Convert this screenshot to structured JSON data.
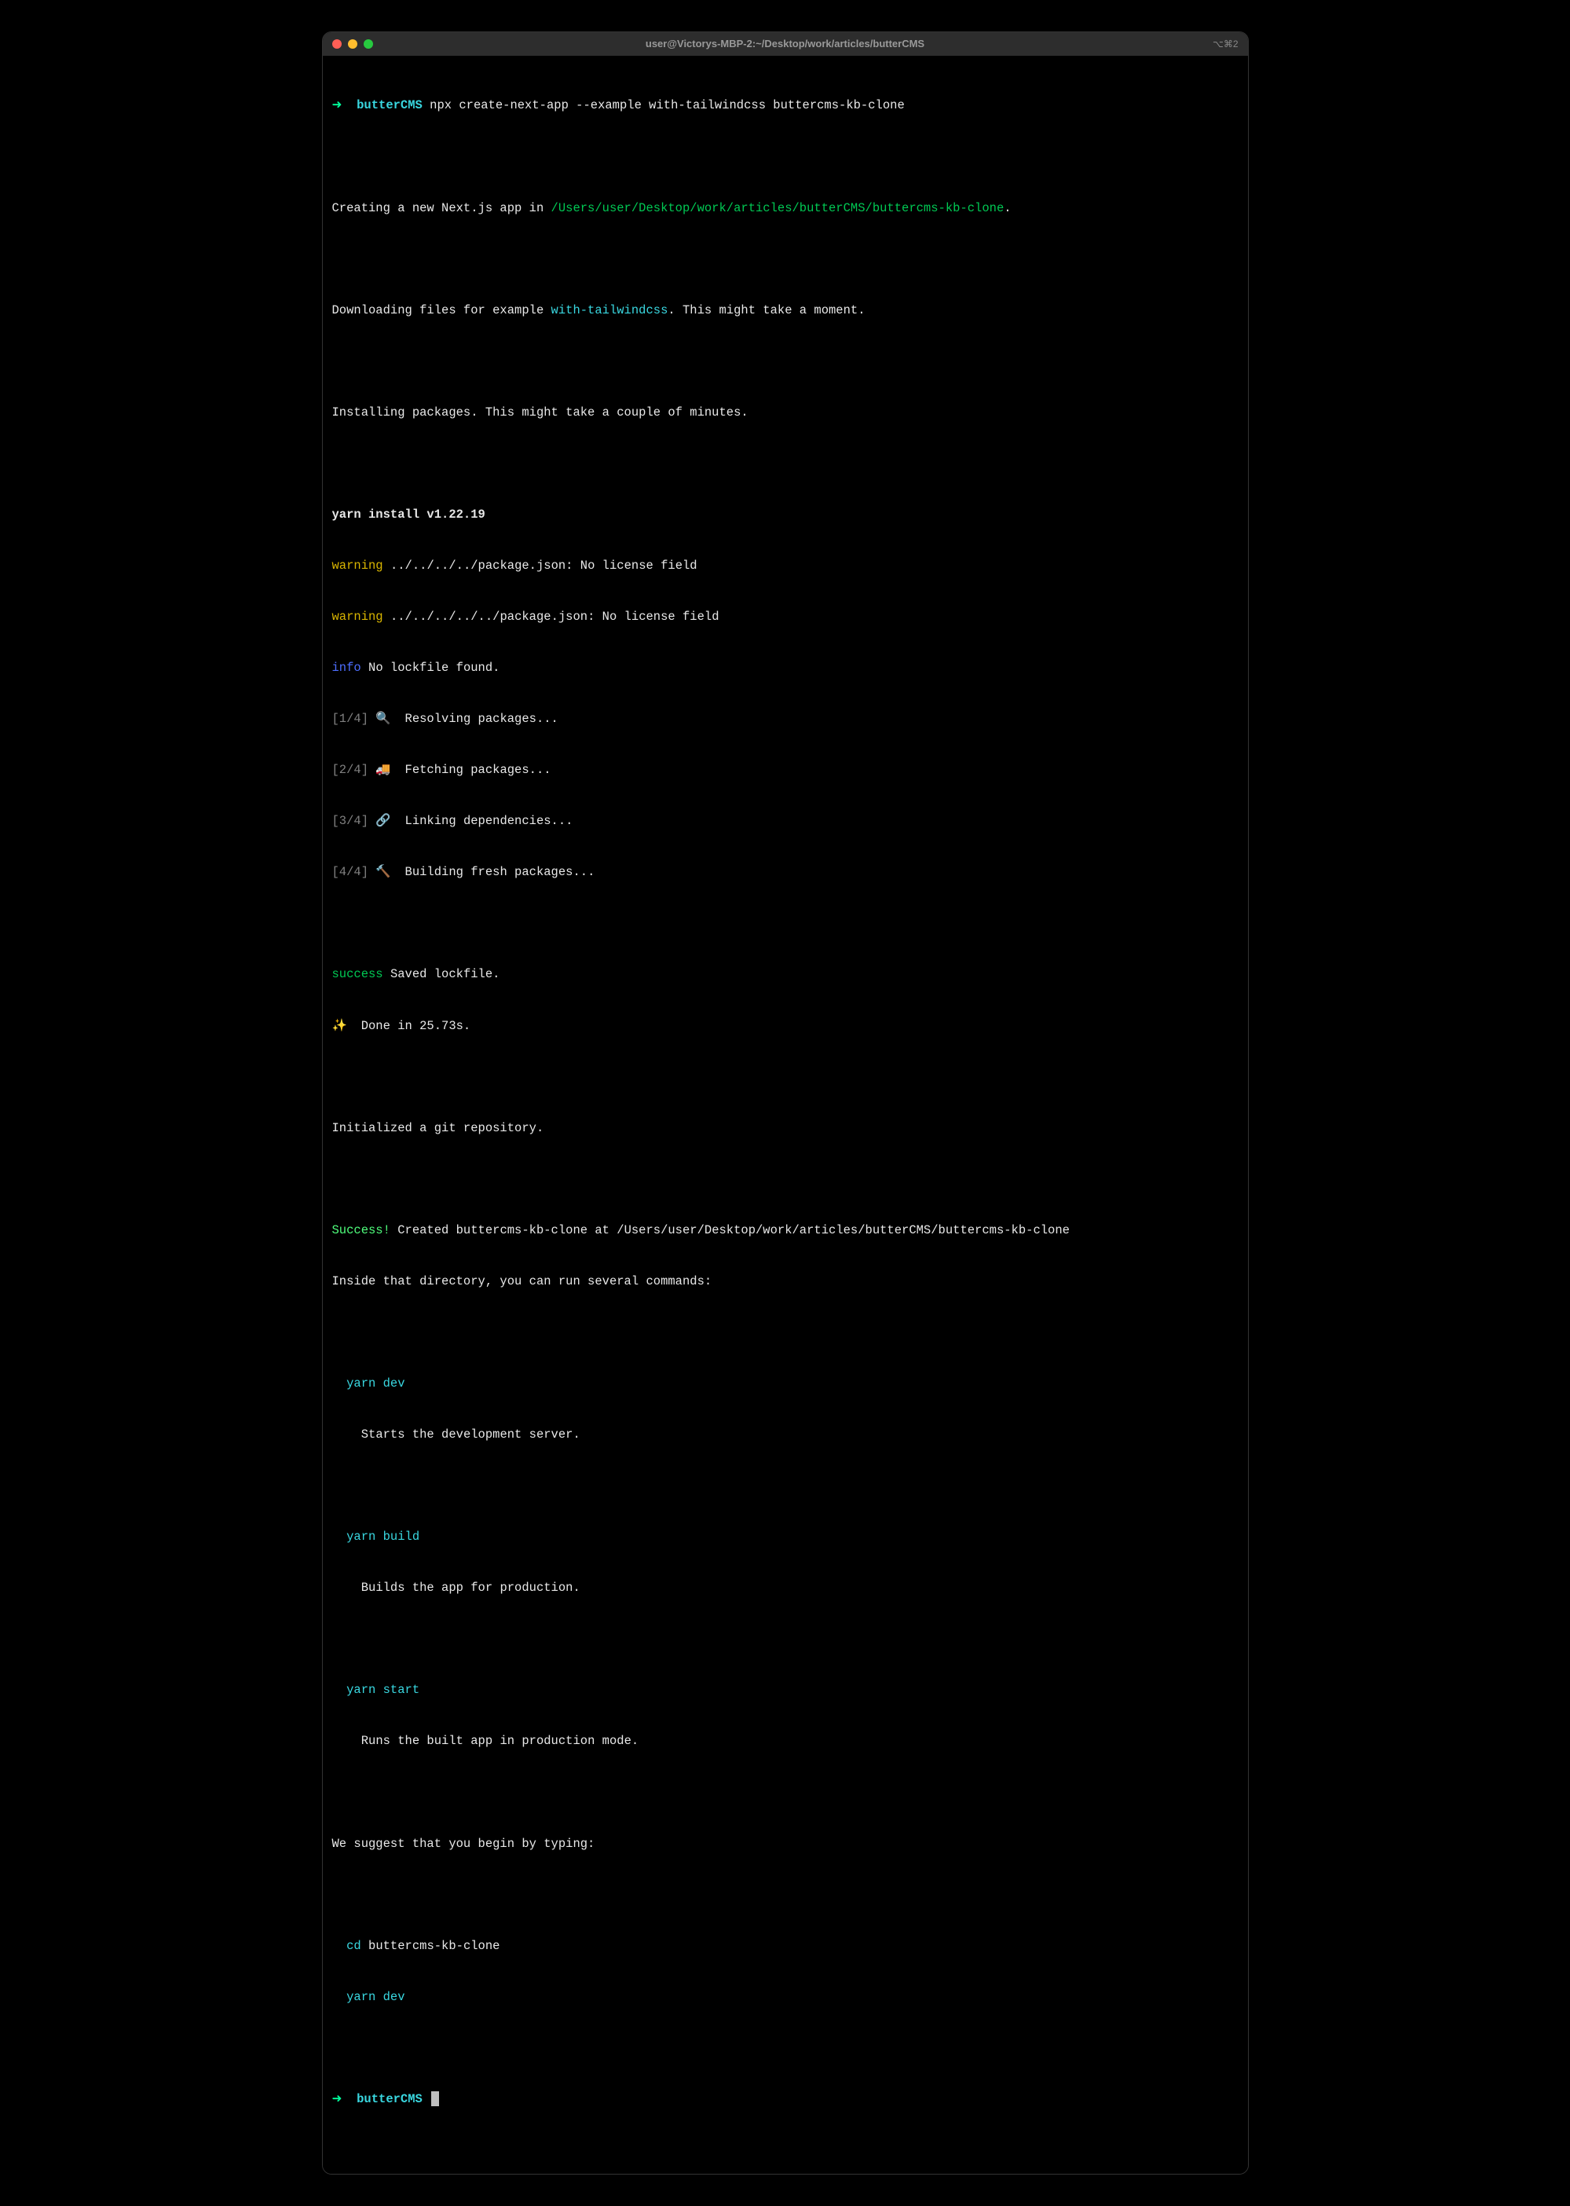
{
  "titlebar": {
    "title": "user@Victorys-MBP-2:~/Desktop/work/articles/butterCMS",
    "right": "⌥⌘2"
  },
  "prompt": {
    "arrow": "➜",
    "dir": "butterCMS",
    "command": "npx create-next-app --example with-tailwindcss buttercms-kb-clone"
  },
  "out": {
    "creating_prefix": "Creating a new Next.js app in ",
    "creating_path": "/Users/user/Desktop/work/articles/butterCMS/buttercms-kb-clone",
    "creating_suffix": ".",
    "downloading_prefix": "Downloading files for example ",
    "downloading_example": "with-tailwindcss",
    "downloading_suffix": ". This might take a moment.",
    "installing": "Installing packages. This might take a couple of minutes.",
    "yarn_install": "yarn install v1.22.19",
    "warning1": "../../../../package.json: No license field",
    "warning2": "../../../../../package.json: No license field",
    "warning_label": "warning",
    "info_label": "info",
    "info_text": "No lockfile found.",
    "step1_prefix": "[1/4]",
    "step1_emoji": "🔍",
    "step1_text": "Resolving packages...",
    "step2_prefix": "[2/4]",
    "step2_emoji": "🚚",
    "step2_text": "Fetching packages...",
    "step3_prefix": "[3/4]",
    "step3_emoji": "🔗",
    "step3_text": "Linking dependencies...",
    "step4_prefix": "[4/4]",
    "step4_emoji": "🔨",
    "step4_text": "Building fresh packages...",
    "success_label": "success",
    "success_text": "Saved lockfile.",
    "done_emoji": "✨",
    "done_text": "Done in 25.73s.",
    "git_init": "Initialized a git repository.",
    "success2_label": "Success!",
    "success2_text": " Created buttercms-kb-clone at /Users/user/Desktop/work/articles/butterCMS/buttercms-kb-clone",
    "inside_text": "Inside that directory, you can run several commands:",
    "cmd1": "yarn dev",
    "cmd1_desc": "Starts the development server.",
    "cmd2": "yarn build",
    "cmd2_desc": "Builds the app for production.",
    "cmd3": "yarn start",
    "cmd3_desc": "Runs the built app in production mode.",
    "suggest": "We suggest that you begin by typing:",
    "cd_cmd": "cd",
    "cd_arg": "buttercms-kb-clone",
    "final_cmd": "yarn dev"
  },
  "prompt2": {
    "arrow": "➜",
    "dir": "butterCMS"
  }
}
